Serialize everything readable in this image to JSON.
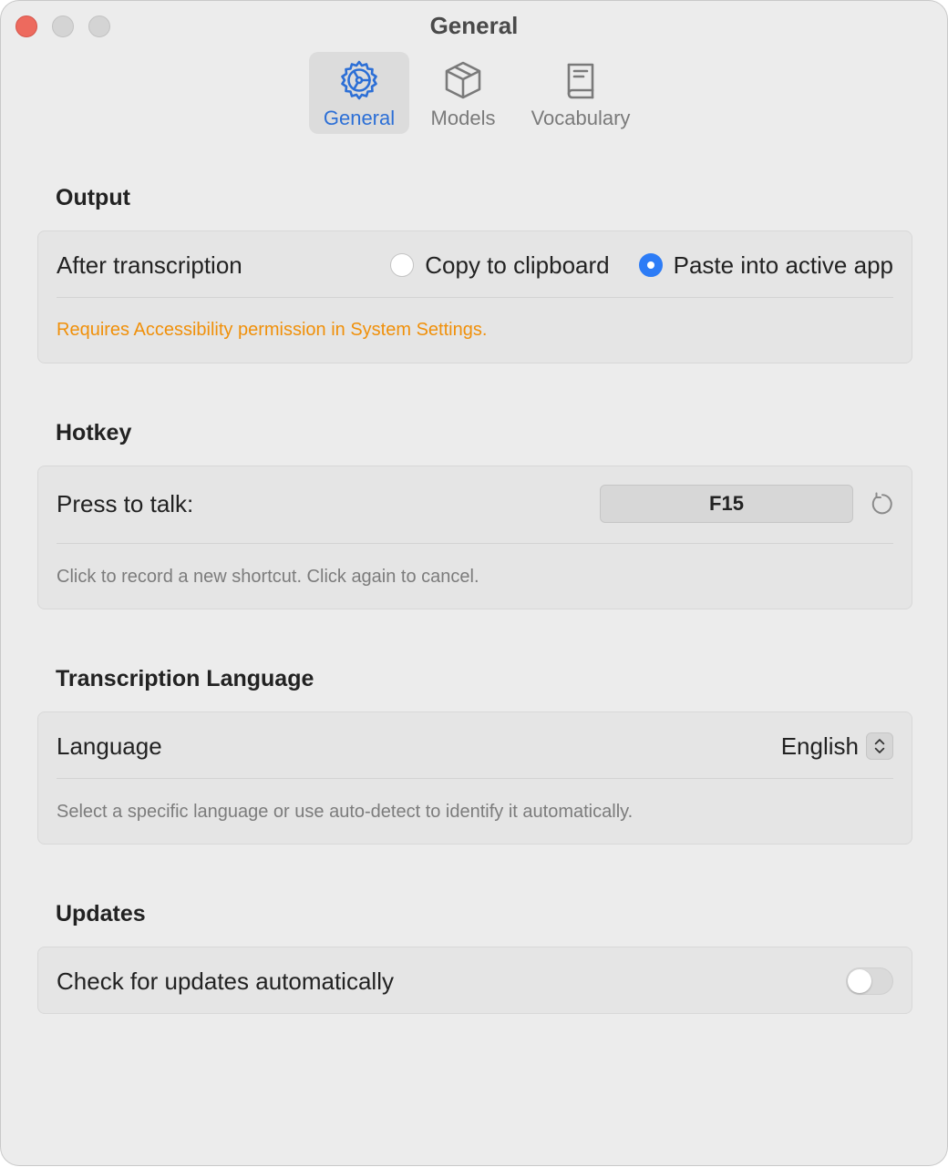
{
  "window": {
    "title": "General"
  },
  "tabs": [
    {
      "label": "General",
      "icon": "gear-icon",
      "active": true
    },
    {
      "label": "Models",
      "icon": "cube-icon",
      "active": false
    },
    {
      "label": "Vocabulary",
      "icon": "book-icon",
      "active": false
    }
  ],
  "output": {
    "title": "Output",
    "after_label": "After transcription",
    "options": [
      {
        "label": "Copy to clipboard",
        "selected": false
      },
      {
        "label": "Paste into active app",
        "selected": true
      }
    ],
    "warning": "Requires Accessibility permission in System Settings."
  },
  "hotkey": {
    "title": "Hotkey",
    "label": "Press to talk:",
    "value": "F15",
    "hint": "Click to record a new shortcut. Click again to cancel."
  },
  "language": {
    "title": "Transcription Language",
    "label": "Language",
    "value": "English",
    "hint": "Select a specific language or use auto-detect to identify it automatically."
  },
  "updates": {
    "title": "Updates",
    "label": "Check for updates automatically",
    "enabled": false
  },
  "colors": {
    "accent": "#2d7cf6",
    "warning": "#f0900a",
    "close": "#ed6a5e"
  }
}
